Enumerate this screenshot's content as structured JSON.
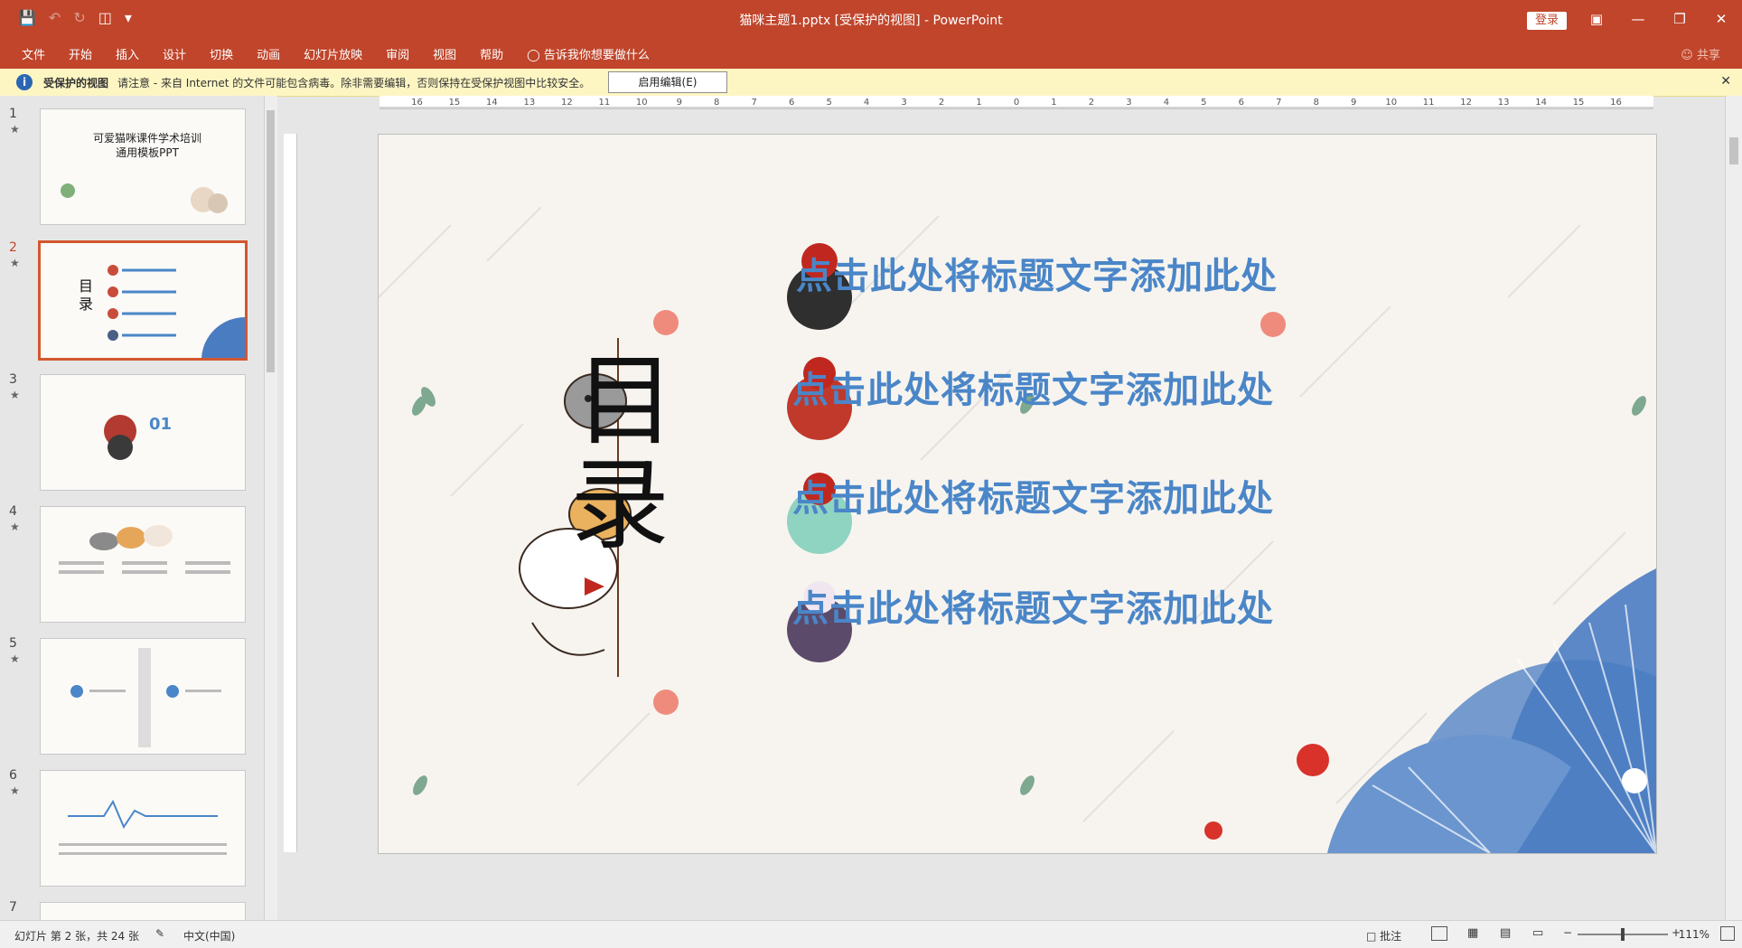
{
  "titlebar": {
    "title": "猫咪主题1.pptx [受保护的视图] - PowerPoint",
    "login_label": "登录",
    "qat_icons": [
      "save-icon",
      "undo-icon",
      "redo-icon",
      "present-icon",
      "customize-icon"
    ]
  },
  "ribbon": {
    "tabs": [
      "文件",
      "开始",
      "插入",
      "设计",
      "切换",
      "动画",
      "幻灯片放映",
      "审阅",
      "视图",
      "帮助",
      "告诉我你想要做什么"
    ],
    "share_label": "共享"
  },
  "protected_bar": {
    "title": "受保护的视图",
    "message": "请注意 - 来自 Internet 的文件可能包含病毒。除非需要编辑，否则保持在受保护视图中比较安全。",
    "enable_button": "启用编辑(E)"
  },
  "thumbnails": {
    "items": [
      {
        "num": "1",
        "star": "★",
        "text": "可爱猫咪课件学术培训通用模板PPT"
      },
      {
        "num": "2",
        "star": "★",
        "text": "目录"
      },
      {
        "num": "3",
        "star": "★",
        "text": "01"
      },
      {
        "num": "4",
        "star": "★",
        "text": ""
      },
      {
        "num": "5",
        "star": "★",
        "text": ""
      },
      {
        "num": "6",
        "star": "★",
        "text": ""
      },
      {
        "num": "7",
        "star": "",
        "text": ""
      }
    ],
    "selected": 2
  },
  "slide": {
    "heading_1": "目",
    "heading_2": "录",
    "entries": [
      "点击此处将标题文字添加此处",
      "点击此处将标题文字添加此处",
      "点击此处将标题文字添加此处",
      "点击此处将标题文字添加此处"
    ],
    "accent_color": "#4a86c8"
  },
  "ruler": {
    "h_ticks": [
      "16",
      "15",
      "14",
      "13",
      "12",
      "11",
      "10",
      "9",
      "8",
      "7",
      "6",
      "5",
      "4",
      "3",
      "2",
      "1",
      "0",
      "1",
      "2",
      "3",
      "4",
      "5",
      "6",
      "7",
      "8",
      "9",
      "10",
      "11",
      "12",
      "13",
      "14",
      "15",
      "16"
    ]
  },
  "statusbar": {
    "slide_info": "幻灯片 第 2 张，共 24 张",
    "language": "中文(中国)",
    "comments": "批注",
    "zoom": "111%"
  },
  "colors": {
    "ppt_red": "#c0452b",
    "protected_bg": "#fdf6c3",
    "fan_blue": "#4a7cc2"
  }
}
